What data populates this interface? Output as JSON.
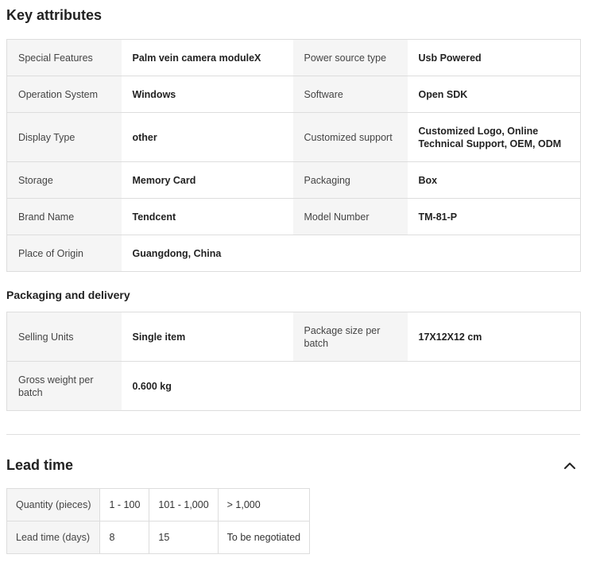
{
  "key_attributes": {
    "title": "Key attributes",
    "rows": [
      [
        {
          "label": "Special Features",
          "value": "Palm vein camera moduleX"
        },
        {
          "label": "Power source type",
          "value": "Usb Powered"
        }
      ],
      [
        {
          "label": "Operation System",
          "value": "Windows"
        },
        {
          "label": "Software",
          "value": "Open SDK"
        }
      ],
      [
        {
          "label": "Display Type",
          "value": "other"
        },
        {
          "label": "Customized support",
          "value": "Customized Logo, Online Technical Support, OEM, ODM"
        }
      ],
      [
        {
          "label": "Storage",
          "value": "Memory Card"
        },
        {
          "label": "Packaging",
          "value": "Box"
        }
      ],
      [
        {
          "label": "Brand Name",
          "value": "Tendcent"
        },
        {
          "label": "Model Number",
          "value": "TM-81-P"
        }
      ],
      [
        {
          "label": "Place of Origin",
          "value": "Guangdong, China"
        }
      ]
    ]
  },
  "packaging": {
    "title": "Packaging and delivery",
    "rows": [
      [
        {
          "label": "Selling Units",
          "value": "Single item"
        },
        {
          "label": "Package size per batch",
          "value": "17X12X12 cm"
        }
      ],
      [
        {
          "label": "Gross weight per batch",
          "value": "0.600 kg"
        }
      ]
    ]
  },
  "lead_time": {
    "title": "Lead time",
    "toggle_icon": "chevron-up-icon",
    "header": [
      "Quantity (pieces)",
      "1 - 100",
      "101 - 1,000",
      "> 1,000"
    ],
    "row": [
      "Lead time (days)",
      "8",
      "15",
      "To be negotiated"
    ]
  }
}
